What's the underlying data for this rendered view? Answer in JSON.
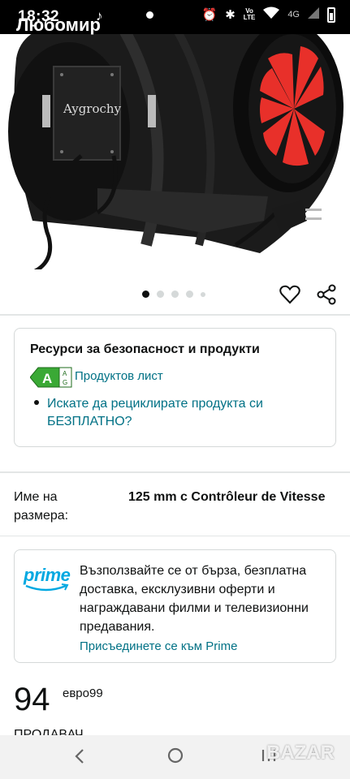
{
  "status_bar": {
    "time": "18:32",
    "user_name": "Любомир",
    "network_label": "4G",
    "volte_top": "Vo",
    "volte_bottom": "LTE"
  },
  "product": {
    "brand_on_device": "Aygrochy",
    "image_count": 5,
    "active_image": 1
  },
  "resources": {
    "title": "Ресурси за безопасност и продукти",
    "energy_class": "A",
    "energy_scale_top": "A",
    "energy_scale_bottom": "G",
    "sheet_link": "Продуктов лист",
    "recycle_link": "Искате да рециклирате продукта си БЕЗПЛАТНО?"
  },
  "size": {
    "label": "Име на размера:",
    "value": "125 mm с Contrôleur de Vitesse"
  },
  "prime": {
    "logo_text": "prime",
    "description": "Възползвайте се от бърза, безплатна доставка, ексклузивни оферти и награждавани филми и телевизионни предавания.",
    "join_link": "Присъединете се към Prime"
  },
  "price": {
    "whole": "94",
    "currency_fraction": "евро99"
  },
  "cut_off_text": "ПРОДАВАЧ",
  "watermark": "BAZAR",
  "colors": {
    "link": "#007185",
    "prime_blue": "#00a8e1",
    "energy_green": "#3aa935",
    "fan_red": "#e8302a"
  }
}
